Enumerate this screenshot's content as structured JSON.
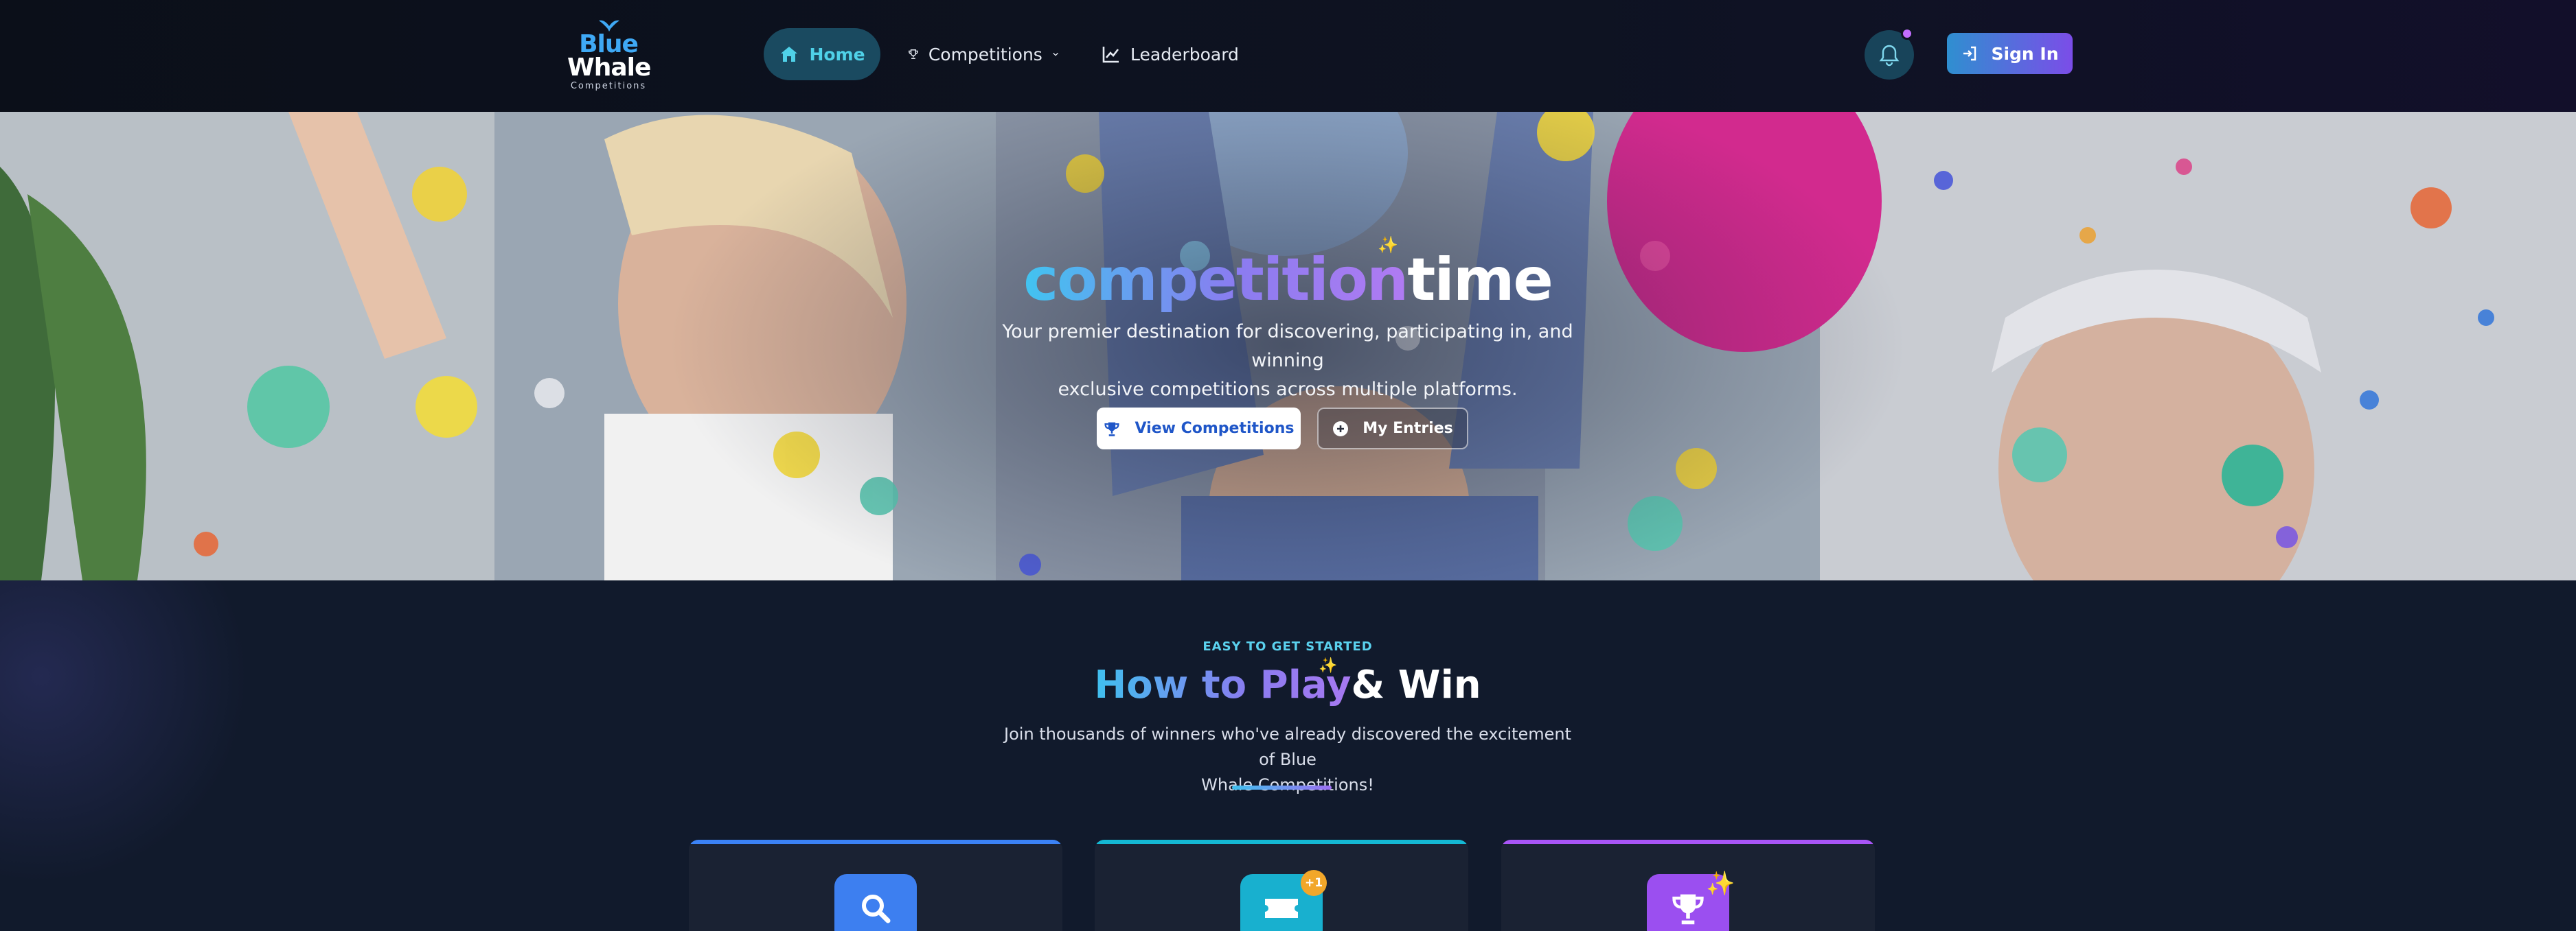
{
  "brand": {
    "line1": "Blue",
    "line2": "Whale",
    "tagline": "Competitions"
  },
  "nav": {
    "home": "Home",
    "competitions": "Competitions",
    "leaderboard": "Leaderboard"
  },
  "header": {
    "signin": "Sign In"
  },
  "hero": {
    "title_gradient": "competition",
    "title_plain": "time",
    "subtitle_line1": "Your premier destination for discovering, participating in, and winning",
    "subtitle_line2": "exclusive competitions across multiple platforms.",
    "view_button": "View Competitions",
    "entries_button": "My Entries"
  },
  "how": {
    "eyebrow": "EASY TO GET STARTED",
    "title_gradient": "How to Play",
    "title_plain": "& Win",
    "subtitle_line1": "Join thousands of winners who've already discovered the excitement of Blue",
    "subtitle_line2": "Whale Competitions!",
    "cards": [
      {
        "icon": "search-icon"
      },
      {
        "icon": "ticket-icon",
        "badge": "+1"
      },
      {
        "icon": "trophy-icon"
      }
    ]
  },
  "colors": {
    "accent_cyan": "#4fd1e8",
    "accent_blue": "#3d7ff0",
    "accent_purple": "#9b4ff0",
    "badge_orange": "#f2a72a",
    "background": "#111a2c"
  }
}
